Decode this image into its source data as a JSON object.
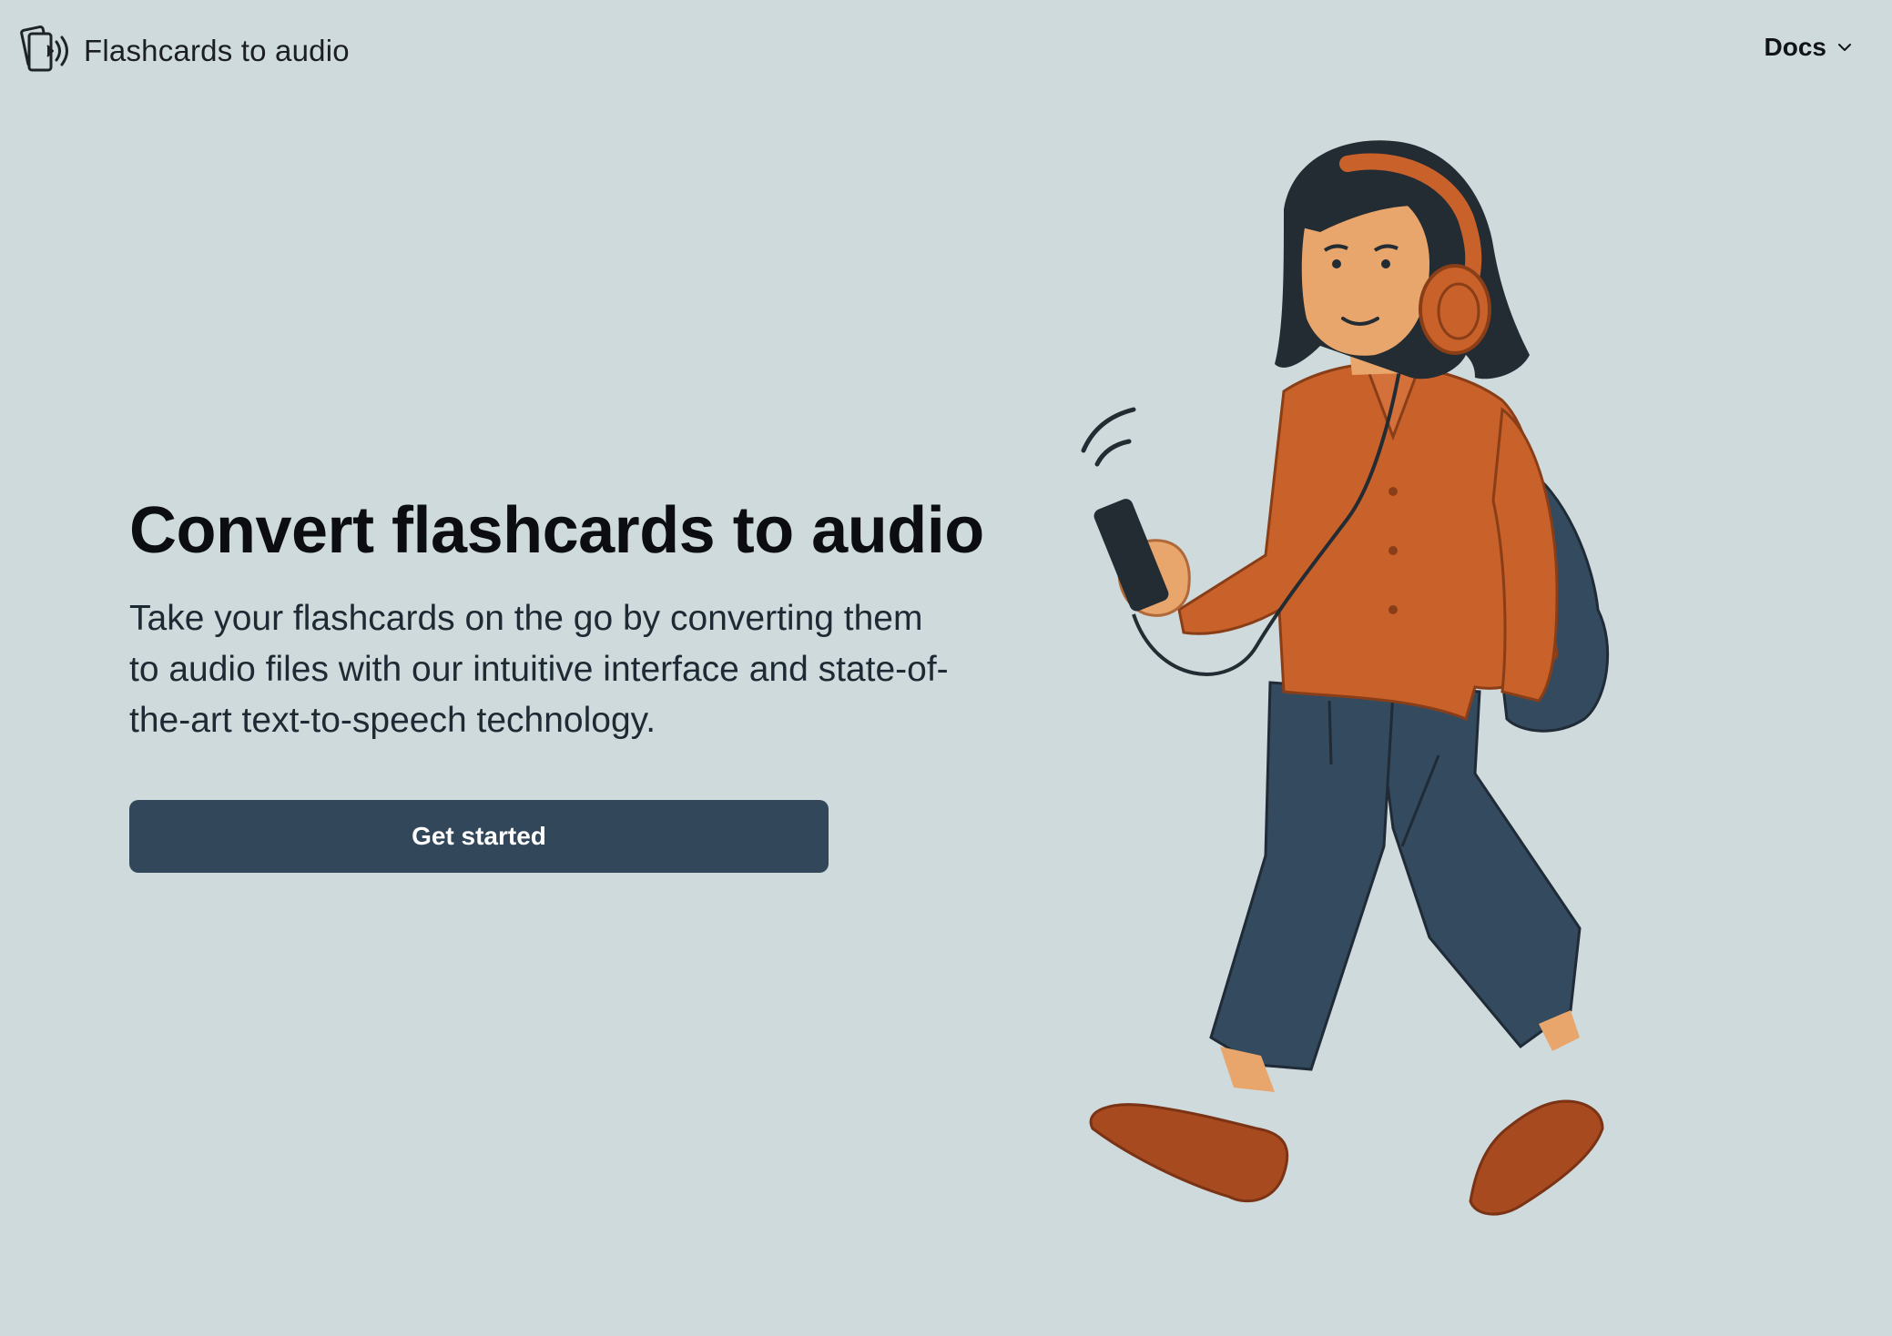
{
  "header": {
    "brand_name": "Flashcards to audio",
    "brand_icon": "cards-audio-icon",
    "docs_label": "Docs",
    "docs_icon": "chevron-down-icon"
  },
  "hero": {
    "title": "Convert flashcards to audio",
    "subtitle": "Take your flashcards on the go by converting them to audio files with our intuitive interface and state-of-the-art text-to-speech technology.",
    "cta_label": "Get started"
  },
  "illustration": {
    "subject": "walking-person-with-headphones"
  },
  "colors": {
    "background": "#cfdadd",
    "button": "#33475a",
    "shirt": "#c9612a",
    "pants": "#344a5e",
    "hair": "#232b33",
    "skin": "#e9a66c"
  }
}
